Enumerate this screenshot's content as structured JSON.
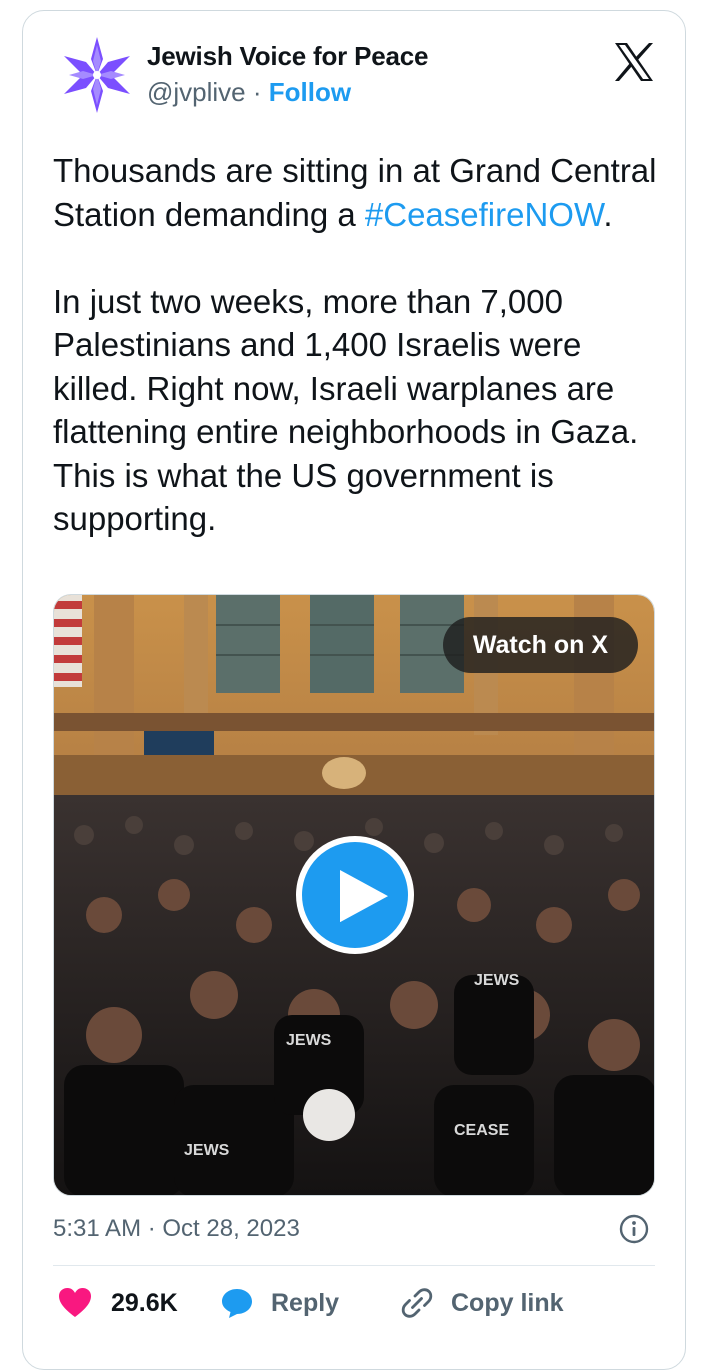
{
  "author": {
    "name": "Jewish Voice for Peace",
    "handle": "@jvplive",
    "separator": " · ",
    "follow_label": "Follow"
  },
  "tweet": {
    "line1_text": "Thousands are sitting in at Grand Central Station demanding a ",
    "hashtag": "#CeasefireNOW",
    "line1_end": ".",
    "paragraph2": "In just two weeks, more than 7,000 Palestinians and 1,400 Israelis were killed. Right now, Israeli warplanes are flattening entire neighborhoods in Gaza. This is what the US government is supporting."
  },
  "media": {
    "watch_label": "Watch on X"
  },
  "timestamp": "5:31 AM · Oct 28, 2023",
  "actions": {
    "like_count": "29.6K",
    "reply_label": "Reply",
    "copy_label": "Copy link"
  },
  "colors": {
    "accent": "#1d9bf0",
    "like": "#f91880",
    "muted": "#536471",
    "logo": "#7b4fff"
  },
  "icons": {
    "logo": "jvp-star-logo",
    "x": "x-logo-icon",
    "play": "play-icon",
    "info": "info-icon",
    "like": "heart-icon",
    "reply": "speech-bubble-icon",
    "copy": "link-icon"
  }
}
